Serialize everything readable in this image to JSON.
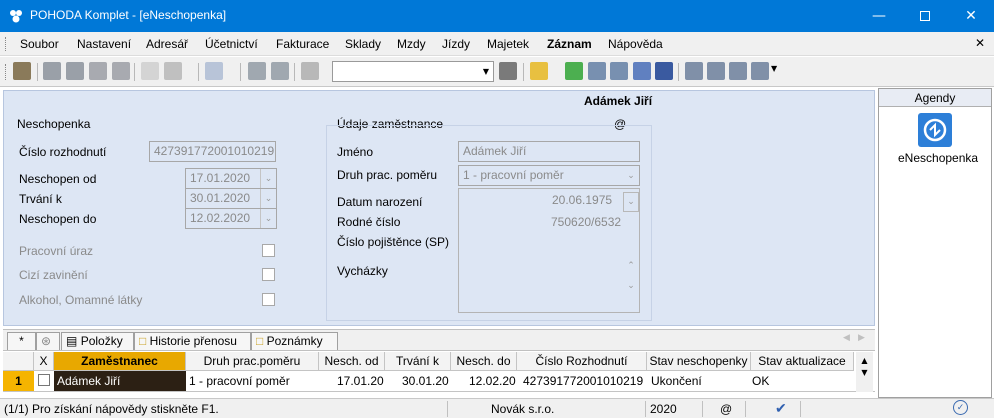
{
  "window": {
    "title": "POHODA Komplet - [eNeschopenka]"
  },
  "menu": [
    "Soubor",
    "Nastavení",
    "Adresář",
    "Účetnictví",
    "Fakturace",
    "Sklady",
    "Mzdy",
    "Jízdy",
    "Majetek",
    "Záznam",
    "Nápověda"
  ],
  "form": {
    "employee_header": "Adámek Jiří",
    "section_left": "Neschopenka",
    "section_right": "Údaje zaměstnance",
    "at_symbol": "@",
    "cislo_rozhodnuti_label": "Číslo rozhodnutí",
    "cislo_rozhodnuti": "427391772001010219",
    "neschopen_od_label": "Neschopen od",
    "neschopen_od": "17.01.2020",
    "trvani_k_label": "Trvání k",
    "trvani_k": "30.01.2020",
    "neschopen_do_label": "Neschopen do",
    "neschopen_do": "12.02.2020",
    "pracovni_uraz_label": "Pracovní úraz",
    "cizi_zavineni_label": "Cizí zavinění",
    "alkohol_label": "Alkohol, Omamné látky",
    "jmeno_label": "Jméno",
    "jmeno": "Adámek Jiří",
    "druh_label": "Druh prac. poměru",
    "druh": "1 - pracovní poměr",
    "datum_narozeni_label": "Datum narození",
    "datum_narozeni": "20.06.1975",
    "rodne_cislo_label": "Rodné číslo",
    "rodne_cislo": "750620/6532",
    "cislo_pojistence_label": "Číslo pojištěnce (SP)",
    "vychazky_label": "Vycházky"
  },
  "agendy": {
    "header": "Agendy",
    "item": "eNeschopenka"
  },
  "tabs": {
    "star": "*",
    "polozky": "Položky",
    "historie": "Historie přenosu",
    "poznamky": "Poznámky"
  },
  "grid": {
    "columns": [
      "X",
      "Zaměstnanec",
      "Druh prac.poměru",
      "Nesch. od",
      "Trvání k",
      "Nesch. do",
      "Číslo Rozhodnutí",
      "Stav neschopenky",
      "Stav aktualizace"
    ],
    "rows": [
      {
        "num": "1",
        "zamestnanec": "Adámek Jiří",
        "druh": "1 - pracovní poměr",
        "od": "17.01.20",
        "trvani": "30.01.20",
        "do": "12.02.20",
        "cislo": "427391772001010219",
        "stav": "Ukončení",
        "aktualizace": "OK"
      }
    ]
  },
  "status": {
    "help": "(1/1) Pro získání nápovědy stiskněte F1.",
    "company": "Novák s.r.o.",
    "year": "2020",
    "at": "@"
  }
}
